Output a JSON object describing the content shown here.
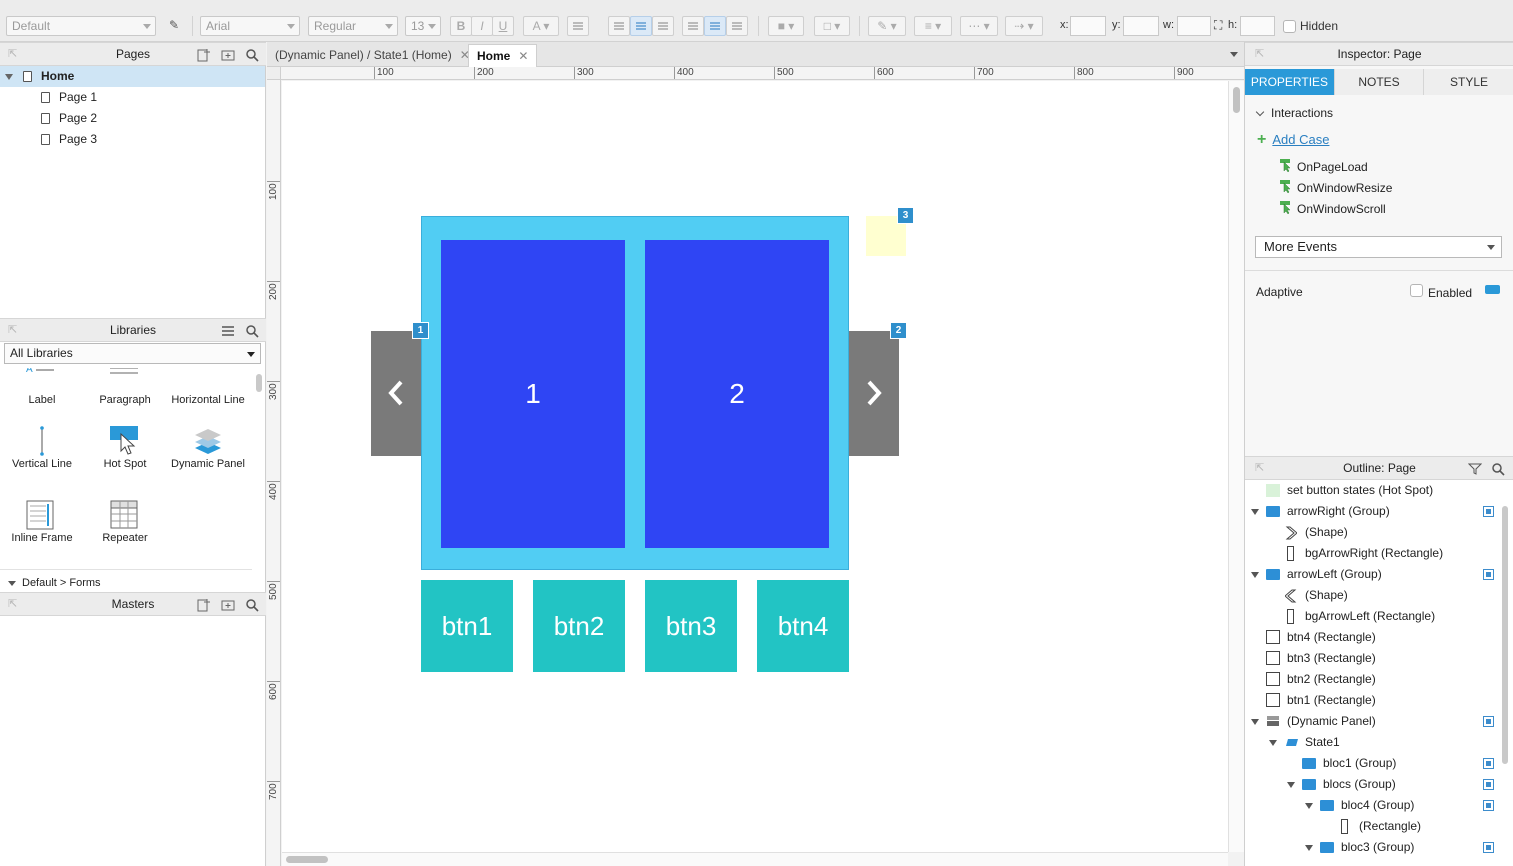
{
  "toolbar": {
    "style_select": "Default",
    "font_select": "Arial",
    "weight_select": "Regular",
    "size_select": "13",
    "x_label": "x:",
    "y_label": "y:",
    "w_label": "w:",
    "h_label": "h:",
    "hidden_label": "Hidden"
  },
  "pages": {
    "title": "Pages",
    "items": [
      {
        "label": "Home"
      },
      {
        "label": "Page 1"
      },
      {
        "label": "Page 2"
      },
      {
        "label": "Page 3"
      }
    ]
  },
  "libraries": {
    "title": "Libraries",
    "selected": "All Libraries",
    "items": [
      {
        "label": "Label"
      },
      {
        "label": "Paragraph"
      },
      {
        "label": "Horizontal Line"
      },
      {
        "label": "Vertical Line"
      },
      {
        "label": "Hot Spot"
      },
      {
        "label": "Dynamic Panel"
      },
      {
        "label": "Inline Frame"
      },
      {
        "label": "Repeater"
      }
    ],
    "section": "Default > Forms"
  },
  "masters": {
    "title": "Masters"
  },
  "tabs": [
    {
      "label": "(Dynamic Panel) / State1 (Home)"
    },
    {
      "label": "Home"
    }
  ],
  "ruler": {
    "h": [
      "100",
      "200",
      "300",
      "400",
      "500",
      "600",
      "700",
      "800",
      "900"
    ],
    "v": [
      "100",
      "200",
      "300",
      "400",
      "500",
      "600",
      "700"
    ]
  },
  "canvas": {
    "slides": [
      "1",
      "2"
    ],
    "buttons": [
      "btn1",
      "btn2",
      "btn3",
      "btn4"
    ],
    "badges": [
      "1",
      "2",
      "3"
    ]
  },
  "inspector": {
    "title": "Inspector: Page",
    "tabs": [
      "PROPERTIES",
      "NOTES",
      "STYLE"
    ],
    "section": "Interactions",
    "add_case": "Add Case",
    "events": [
      "OnPageLoad",
      "OnWindowResize",
      "OnWindowScroll"
    ],
    "more_events": "More Events",
    "adaptive": "Adaptive",
    "enabled": "Enabled"
  },
  "outline": {
    "title": "Outline: Page",
    "rows": [
      {
        "label": "set button states (Hot Spot)"
      },
      {
        "label": "arrowRight (Group)"
      },
      {
        "label": "(Shape)"
      },
      {
        "label": "bgArrowRight (Rectangle)"
      },
      {
        "label": "arrowLeft (Group)"
      },
      {
        "label": "(Shape)"
      },
      {
        "label": "bgArrowLeft (Rectangle)"
      },
      {
        "label": "btn4 (Rectangle)"
      },
      {
        "label": "btn3 (Rectangle)"
      },
      {
        "label": "btn2 (Rectangle)"
      },
      {
        "label": "btn1 (Rectangle)"
      },
      {
        "label": "(Dynamic Panel)"
      },
      {
        "label": "State1"
      },
      {
        "label": "bloc1 (Group)"
      },
      {
        "label": "blocs (Group)"
      },
      {
        "label": "bloc4 (Group)"
      },
      {
        "label": "(Rectangle)"
      },
      {
        "label": "bloc3 (Group)"
      }
    ]
  },
  "colors": {
    "accent": "#2a99d8",
    "slide_frame": "#51cdf3",
    "slide_block": "#2f45f4",
    "button": "#22c4c4",
    "arrow_bg": "#7a7a7a",
    "hotspot": "#ffffd0"
  }
}
